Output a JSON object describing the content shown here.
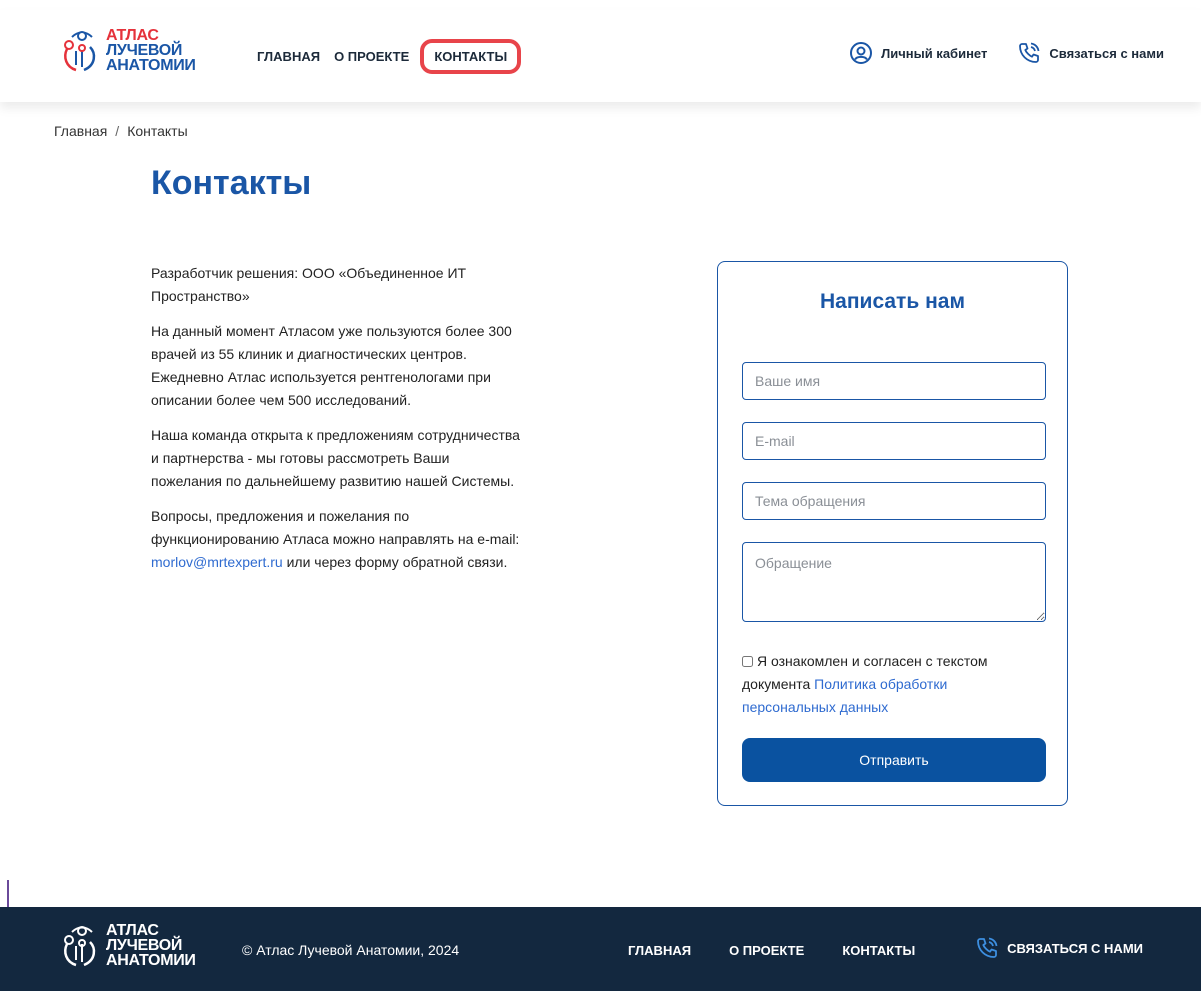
{
  "header": {
    "logo": {
      "line1": "АТЛАС",
      "line2": "ЛУЧЕВОЙ",
      "line3": "АНАТОМИИ"
    },
    "nav": [
      {
        "label": "ГЛАВНАЯ"
      },
      {
        "label": "О ПРОЕКТЕ"
      },
      {
        "label": "КОНТАКТЫ",
        "active": true
      }
    ],
    "account_label": "Личный кабинет",
    "contact_label": "Связаться с нами"
  },
  "breadcrumb": {
    "home": "Главная",
    "separator": "/",
    "current": "Контакты"
  },
  "page_title": "Контакты",
  "about": {
    "p1": "Разработчик решения: ООО «Объединенное ИТ Пространство»",
    "p2": "На данный момент Атласом уже пользуются более 300 врачей из 55 клиник и диагностических центров. Ежедневно Атлас используется рентгенологами при описании более чем 500 исследований.",
    "p3": "Наша команда открыта к предложениям сотрудничества и партнерства - мы готовы рассмотреть Ваши пожелания по дальнейшему развитию нашей Системы.",
    "p4_start": "Вопросы, предложения и пожелания по функционированию Атласа можно направлять на e-mail: ",
    "p4_email": "morlov@mrtexpert.ru",
    "p4_end": " или через форму обратной связи."
  },
  "form": {
    "title": "Написать нам",
    "name_placeholder": "Ваше имя",
    "email_placeholder": "E-mail",
    "subject_placeholder": "Тема обращения",
    "message_placeholder": "Обращение",
    "consent_text": "Я ознакомлен и согласен с текстом документа ",
    "consent_link": "Политика обработки персональных данных",
    "submit_label": "Отправить"
  },
  "footer": {
    "logo": {
      "line1": "АТЛАС",
      "line2": "ЛУЧЕВОЙ",
      "line3": "АНАТОМИИ"
    },
    "copyright": "© Атлас Лучевой Анатомии, 2024",
    "nav": [
      {
        "label": "ГЛАВНАЯ"
      },
      {
        "label": "О ПРОЕКТЕ"
      },
      {
        "label": "КОНТАКТЫ"
      }
    ],
    "contact_label": "СВЯЗАТЬСЯ С НАМИ"
  },
  "colors": {
    "brand_blue": "#1a56a6",
    "brand_red": "#e5323b",
    "button": "#0a52a0",
    "footer_bg": "#13283f",
    "active_highlight": "#e8444a"
  },
  "icons": [
    "atlas-logo-icon",
    "user-circle-icon",
    "phone-call-icon"
  ]
}
